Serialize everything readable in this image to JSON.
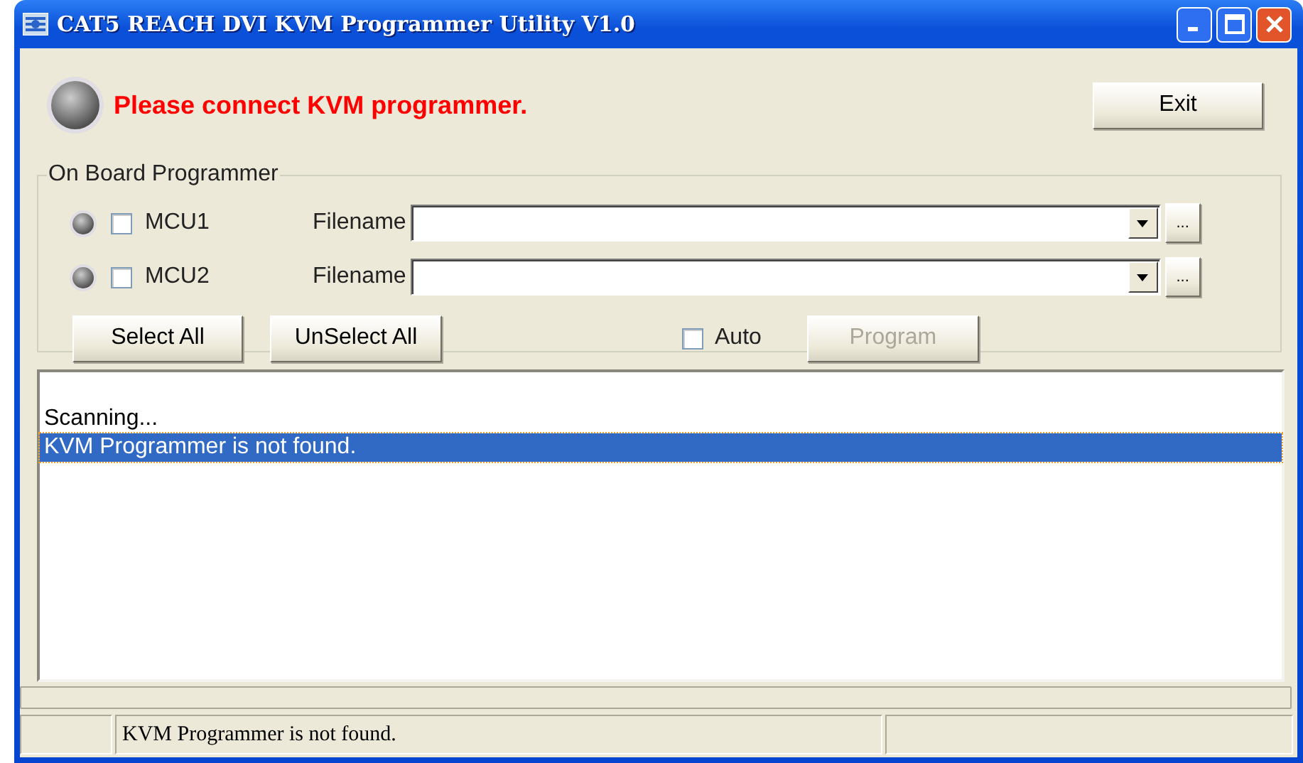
{
  "window": {
    "title": "CAT5 REACH DVI KVM Programmer Utility V1.0"
  },
  "status": {
    "lit": false,
    "message": "Please connect KVM programmer."
  },
  "exit_button": "Exit",
  "group": {
    "title": "On Board Programmer",
    "mcus": [
      {
        "lit": false,
        "checked": false,
        "label": "MCU1",
        "filename_label": "Filename",
        "browse": "..."
      },
      {
        "lit": false,
        "checked": false,
        "label": "MCU2",
        "filename_label": "Filename",
        "browse": "..."
      }
    ],
    "select_all": "Select All",
    "unselect_all": "UnSelect All",
    "auto": {
      "label": "Auto",
      "checked": false
    },
    "program": {
      "label": "Program",
      "disabled": true
    }
  },
  "log": [
    {
      "text": "Scanning...",
      "selected": false
    },
    {
      "text": "KVM Programmer is not found.",
      "selected": true
    }
  ],
  "status_bar": {
    "message": "KVM Programmer is not found."
  }
}
